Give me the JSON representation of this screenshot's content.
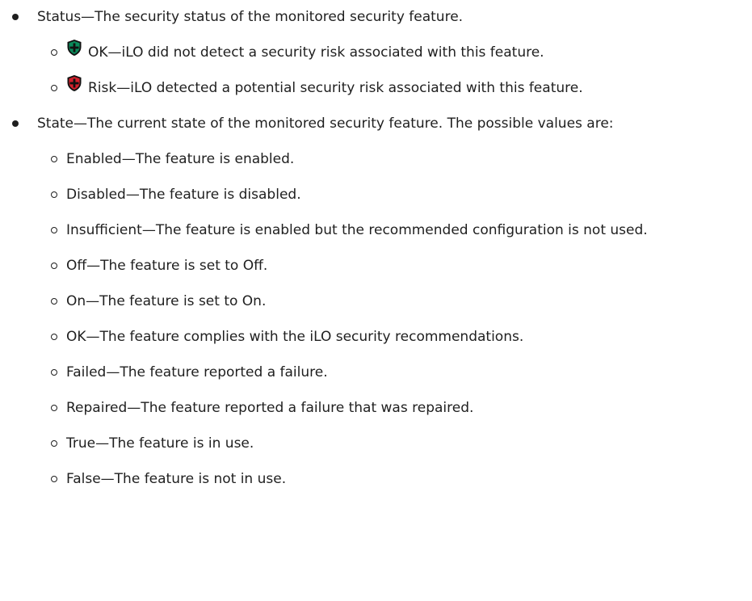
{
  "items": [
    {
      "text": "Status—The security status of the monitored security feature.",
      "subitems": [
        {
          "icon": "shield-ok-icon",
          "icon_color": "#0a8a5a",
          "text": "OK—iLO did not detect a security risk associated with this feature."
        },
        {
          "icon": "shield-risk-icon",
          "icon_color": "#d4202c",
          "text": "Risk—iLO detected a potential security risk associated with this feature."
        }
      ]
    },
    {
      "text": "State—The current state of the monitored security feature. The possible values are:",
      "subitems": [
        {
          "text": "Enabled—The feature is enabled."
        },
        {
          "text": "Disabled—The feature is disabled."
        },
        {
          "text": "Insufficient—The feature is enabled but the recommended configuration is not used."
        },
        {
          "text": "Off—The feature is set to  Off."
        },
        {
          "text": "On—The feature is set to  On."
        },
        {
          "text": "OK—The feature complies with the  iLO security recommendations."
        },
        {
          "text": "Failed—The feature reported a failure."
        },
        {
          "text": "Repaired—The feature reported a failure that was repaired."
        },
        {
          "text": "True—The feature is in use."
        },
        {
          "text": "False—The feature is not in use."
        }
      ]
    }
  ]
}
